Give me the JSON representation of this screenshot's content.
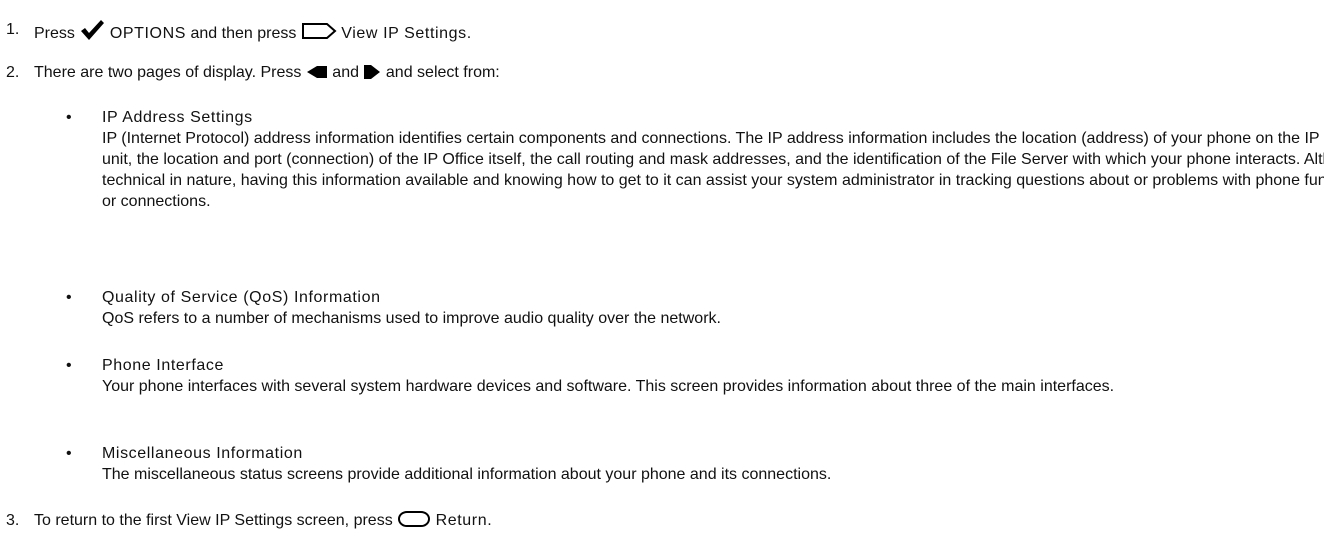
{
  "steps": [
    {
      "number": "1.",
      "press": "Press",
      "options": "OPTIONS",
      "and_then_press": "and then press",
      "view_ip_settings": "View IP Settings."
    },
    {
      "number": "2.",
      "text_before": "There are two pages of display. Press",
      "and": "and",
      "text_after": "and select from:"
    },
    {
      "number": "3.",
      "text_before": "To return to the first View IP Settings screen, press",
      "return_label": "Return."
    }
  ],
  "bullets": [
    {
      "marker": "•",
      "title": "IP Address Settings",
      "description": "IP (Internet Protocol) address information identifies certain components and connections. The IP address information includes the location (address) of your phone on the IP Office unit, the location and port (connection) of the IP Office itself, the call routing and mask addresses, and the identification of the File Server with which your phone interacts. Although technical in nature, having this information available and knowing how to get to it can assist your system administrator in tracking questions about or problems with phone functions or connections."
    },
    {
      "marker": "•",
      "title": "Quality of Service (QoS) Information",
      "description": "QoS refers to a number of mechanisms used to improve audio quality over the network."
    },
    {
      "marker": "•",
      "title": "Phone Interface",
      "description": "Your phone interfaces with several system hardware devices and software. This screen provides information about three of the main interfaces."
    },
    {
      "marker": "•",
      "title": "Miscellaneous Information",
      "description": "The miscellaneous status screens provide additional information about your phone and its connections."
    }
  ],
  "icons": {
    "options": "checkmark-icon",
    "softkey": "softkey-button-icon",
    "left_arrow": "left-arrow-icon",
    "right_arrow": "right-arrow-icon",
    "return": "return-button-icon"
  }
}
